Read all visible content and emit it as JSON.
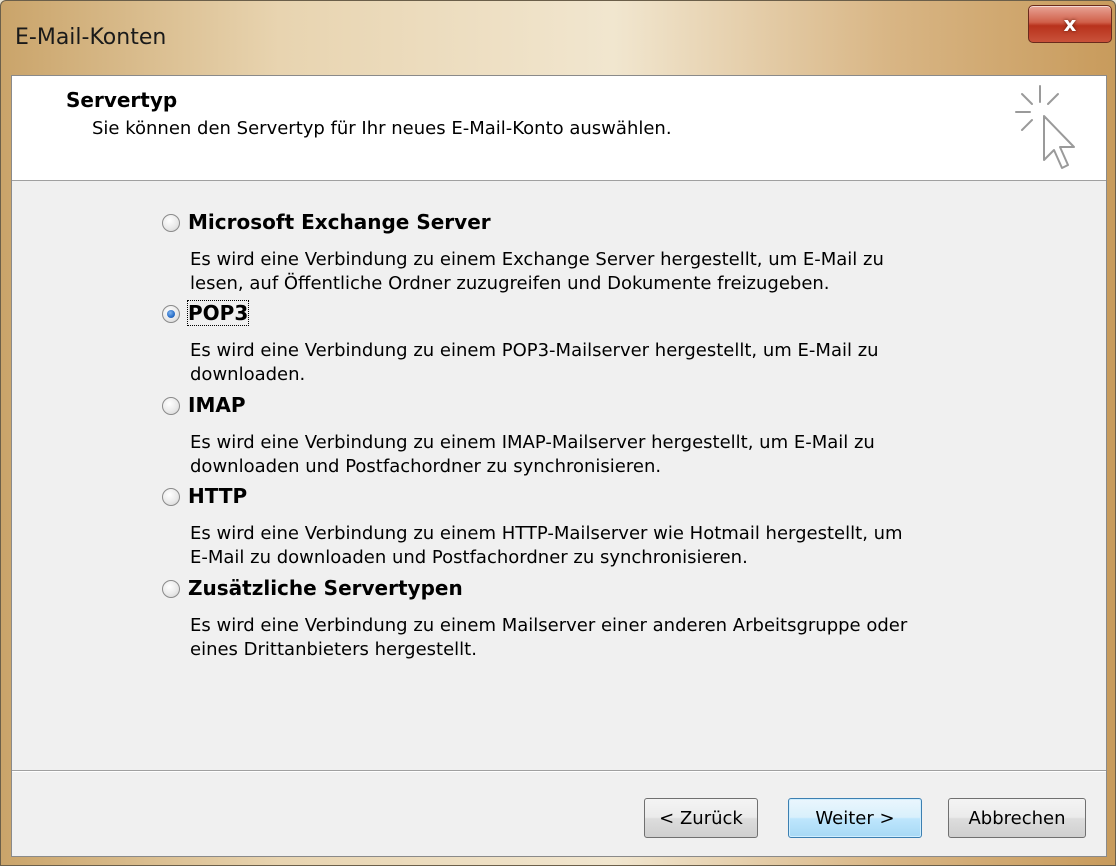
{
  "window": {
    "title": "E-Mail-Konten",
    "close_label": "x"
  },
  "header": {
    "title": "Servertyp",
    "subtitle": "Sie können den Servertyp für Ihr neues E-Mail-Konto auswählen.",
    "icon": "cursor-click-icon"
  },
  "options": [
    {
      "label": "Microsoft Exchange Server",
      "description_1": "Es wird eine Verbindung zu einem Exchange Server hergestellt, um E-Mail zu",
      "description_2": "lesen, auf Öffentliche Ordner zuzugreifen und Dokumente freizugeben.",
      "checked": false
    },
    {
      "label": "POP3",
      "description_1": "Es wird eine Verbindung zu einem POP3-Mailserver hergestellt, um E-Mail zu",
      "description_2": "downloaden.",
      "checked": true
    },
    {
      "label": "IMAP",
      "description_1": "Es wird eine Verbindung zu einem IMAP-Mailserver hergestellt, um E-Mail zu",
      "description_2": "downloaden und Postfachordner zu synchronisieren.",
      "checked": false
    },
    {
      "label": "HTTP",
      "description_1": "Es wird eine Verbindung zu einem HTTP-Mailserver wie Hotmail hergestellt, um",
      "description_2": "E-Mail zu downloaden und Postfachordner zu synchronisieren.",
      "checked": false
    },
    {
      "label": "Zusätzliche Servertypen",
      "description_1": "Es wird eine Verbindung zu einem Mailserver einer anderen Arbeitsgruppe oder",
      "description_2": "eines Drittanbieters hergestellt.",
      "checked": false
    }
  ],
  "buttons": {
    "back": "< Zurück",
    "next": "Weiter >",
    "cancel": "Abbrechen"
  }
}
